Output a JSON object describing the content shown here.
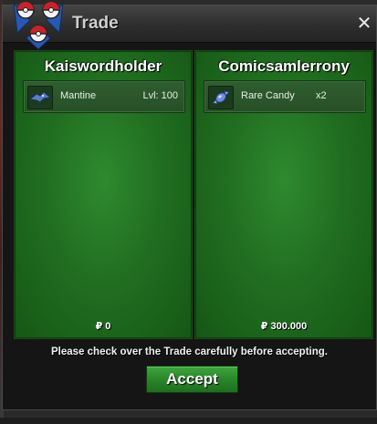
{
  "window": {
    "title": "Trade",
    "close_label": "✕"
  },
  "trade": {
    "left": {
      "player_name": "Kaiswordholder",
      "item": {
        "name": "Mantine",
        "meta": "Lvl: 100",
        "icon": "mantine-sprite-icon"
      },
      "money": "₽ 0"
    },
    "right": {
      "player_name": "Comicsamlerrony",
      "item": {
        "name": "Rare Candy",
        "qty": "x2",
        "icon": "rare-candy-sprite-icon"
      },
      "money": "₽ 300.000"
    }
  },
  "footer": {
    "notice": "Please check over the Trade carefully before accepting.",
    "accept_label": "Accept"
  },
  "colors": {
    "panel_green": "#216f21",
    "button_green": "#2a862a",
    "logo_red": "#c8232c",
    "logo_blue": "#2a58b0"
  }
}
